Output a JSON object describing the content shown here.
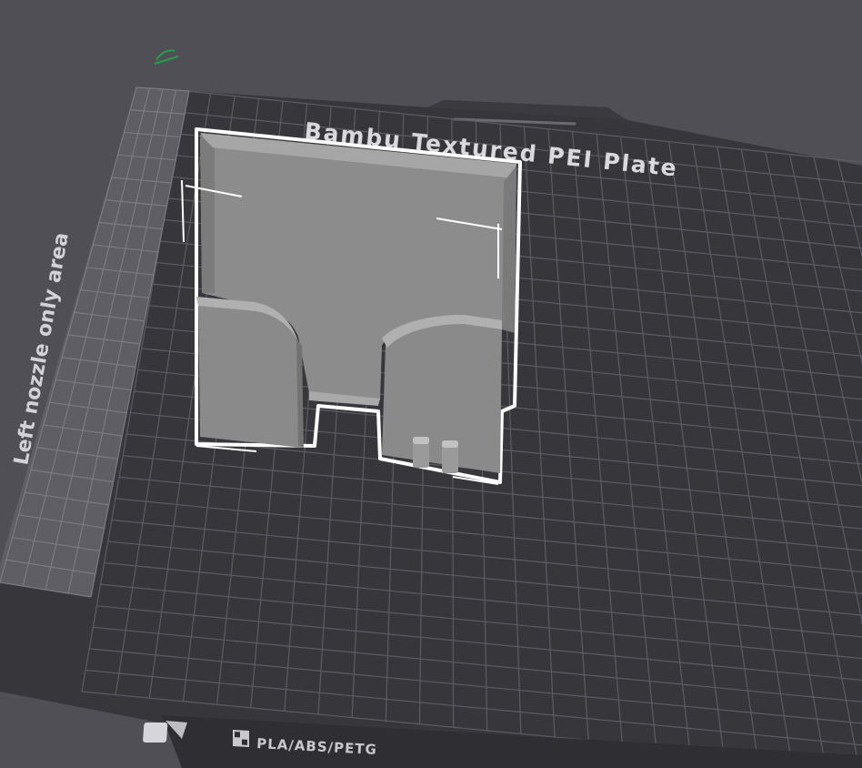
{
  "viewport": {
    "background": "#4f4f55",
    "bed_color": "#36363b",
    "grid_color": "#5a5a60",
    "selection_outline_color": "#ffffff",
    "model_color": "#8e8e8e",
    "axis_marker_color": "#1fa34a"
  },
  "build_plate": {
    "name": "Bambu Textured PEI Plate",
    "zone_label": "Left nozzle only area",
    "materials_label": "PLA/ABS/PETG"
  },
  "icons": {
    "axis_marker": "axis-marker-icon",
    "plate_type": "plate-type-icon",
    "plate_slot_left": "triangle-slot-icon",
    "plate_slot_square": "square-slot-icon"
  }
}
